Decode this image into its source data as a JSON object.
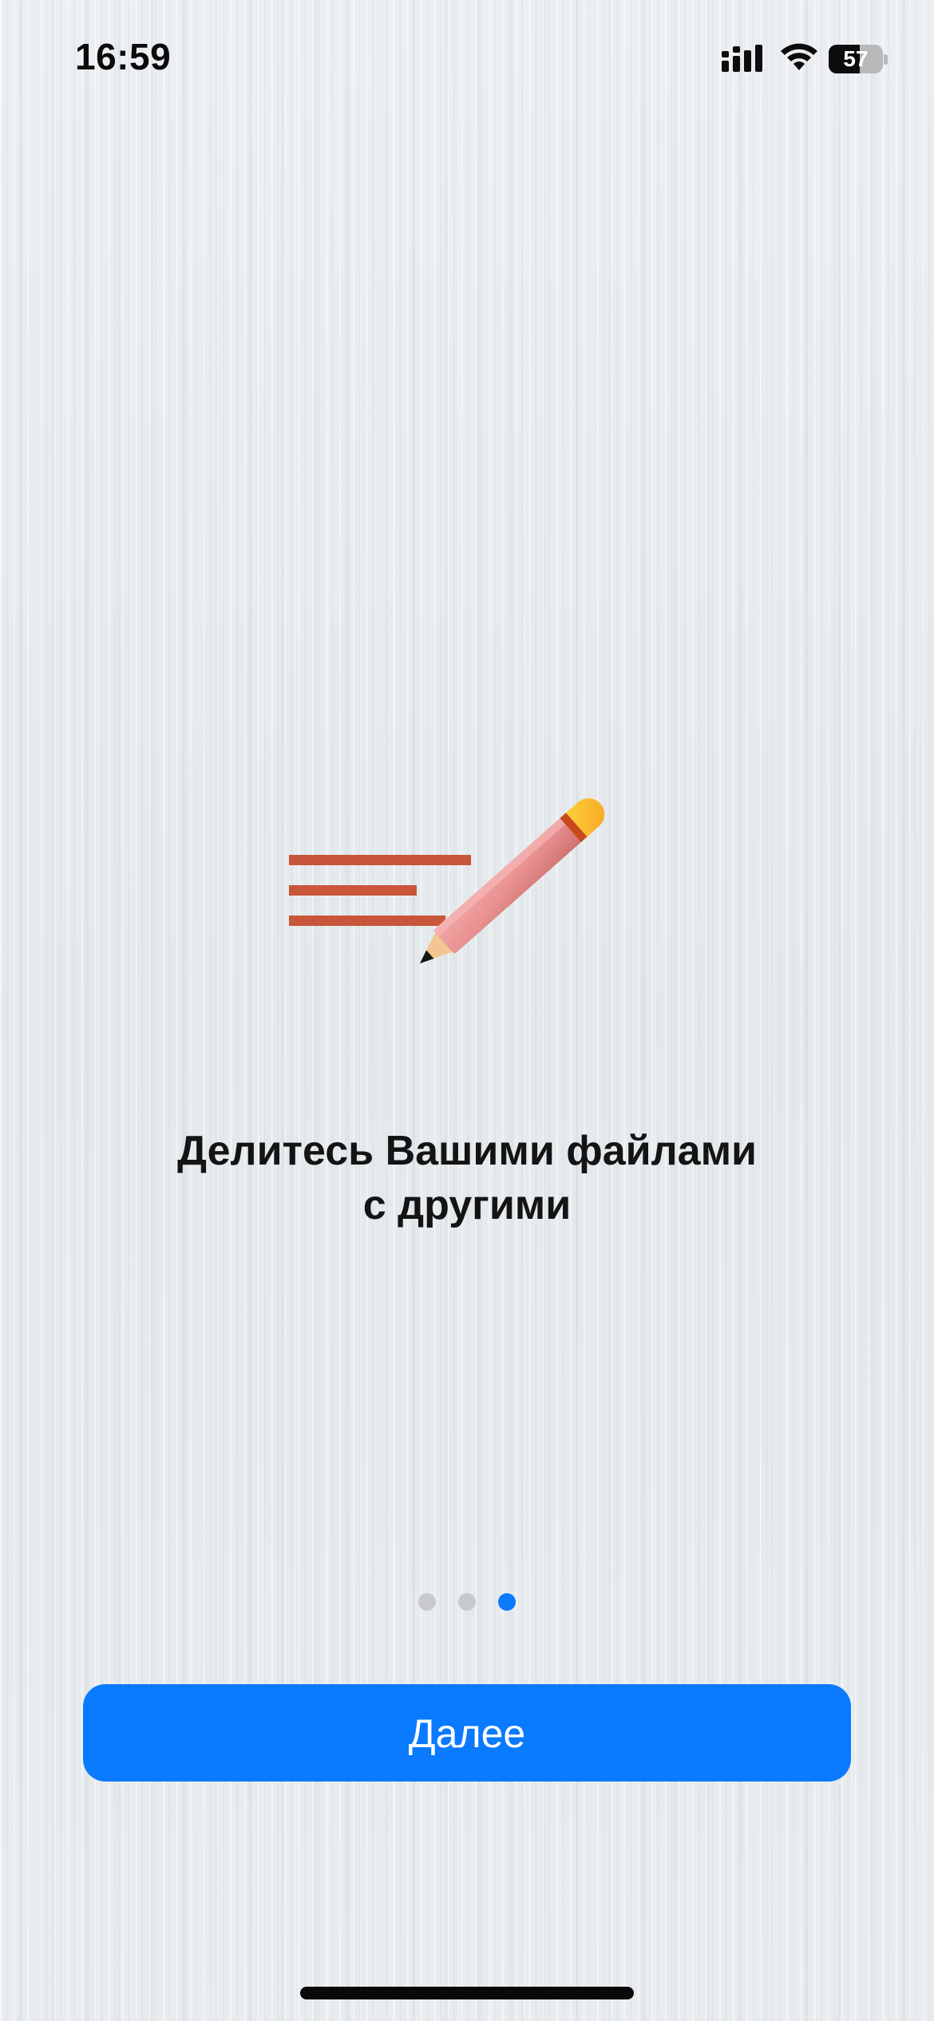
{
  "status_bar": {
    "time": "16:59",
    "battery_level": "57",
    "battery_fraction": 0.57,
    "icons": [
      "cellular-signal-icon",
      "wifi-icon",
      "battery-icon"
    ]
  },
  "onboarding": {
    "illustration": "pencil-writing-icon",
    "headline_line1": "Делитесь Вашими файлами",
    "headline_line2": "с другими",
    "page_count": 3,
    "current_page": 3
  },
  "next_button": {
    "label": "Далее"
  },
  "colors": {
    "accent": "#0a7aff",
    "inactive_dot": "#c7c9cc",
    "text": "#141414"
  }
}
